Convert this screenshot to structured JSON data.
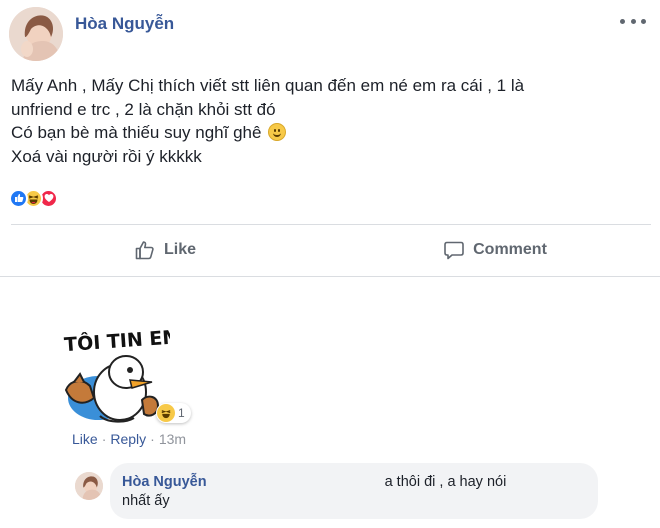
{
  "post": {
    "author": "Hòa Nguyễn",
    "lines": [
      "Mấy Anh , Mấy Chị thích viết stt liên quan đến em né em ra cái , 1 là",
      "unfriend e trc , 2 là chặn khỏi stt đó",
      "Có bạn bè mà thiếu suy nghĩ ghê",
      "Xoá vài người rồi ý kkkkk"
    ],
    "reactions": [
      "like-icon",
      "haha-icon",
      "love-icon"
    ]
  },
  "actions": {
    "like_label": "Like",
    "comment_label": "Comment"
  },
  "comment": {
    "sticker_text": "TÔI TIN EM",
    "reaction_count": "1",
    "like_label": "Like",
    "separator": "·",
    "reply_label": "Reply",
    "time": "13m"
  },
  "reply": {
    "author": "Hòa Nguyễn",
    "text_part1": "a thôi đi , a hay nói",
    "text_part2": "nhất ấy"
  },
  "colors": {
    "link_blue": "#385898",
    "like_blue": "#2078f4",
    "love_red": "#f0284a",
    "haha_yellow": "#f7c948",
    "muted": "#606770"
  }
}
